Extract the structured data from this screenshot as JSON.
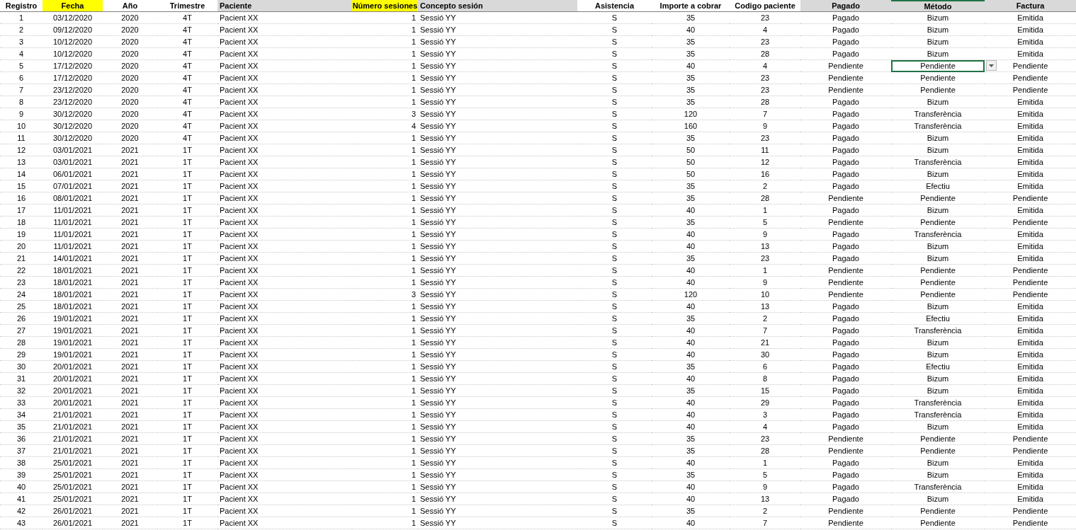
{
  "table": {
    "columns": [
      {
        "label": "Registro",
        "color": "#ffffff",
        "selected": false
      },
      {
        "label": "Fecha",
        "color": "#ffff00",
        "selected": false
      },
      {
        "label": "Año",
        "color": "#ffffff",
        "selected": false
      },
      {
        "label": "Trimestre",
        "color": "#ffffff",
        "selected": false
      },
      {
        "label": "Paciente",
        "color": "#d9d9d9",
        "selected": false
      },
      {
        "label": "Número sesiones",
        "color": "#ffff00",
        "selected": false
      },
      {
        "label": "Concepto sesión",
        "color": "#d9d9d9",
        "selected": false
      },
      {
        "label": "Asistencia",
        "color": "#ffffff",
        "selected": false
      },
      {
        "label": "Importe a cobrar",
        "color": "#ffffff",
        "selected": false
      },
      {
        "label": "Codigo paciente",
        "color": "#ffffff",
        "selected": false
      },
      {
        "label": "Pagado",
        "color": "#d9d9d9",
        "selected": false
      },
      {
        "label": "Método",
        "color": "#d9d9d9",
        "selected": true
      },
      {
        "label": "Factura",
        "color": "#d9d9d9",
        "selected": false
      }
    ],
    "rows": [
      {
        "selected": false,
        "cells": [
          "1",
          "03/12/2020",
          "2020",
          "4T",
          "Pacient XX",
          "1",
          "Sessió YY",
          "S",
          "35",
          "23",
          "Pagado",
          "Bizum",
          "Emitida"
        ]
      },
      {
        "selected": false,
        "cells": [
          "2",
          "09/12/2020",
          "2020",
          "4T",
          "Pacient XX",
          "1",
          "Sessió YY",
          "S",
          "40",
          "4",
          "Pagado",
          "Bizum",
          "Emitida"
        ]
      },
      {
        "selected": false,
        "cells": [
          "3",
          "10/12/2020",
          "2020",
          "4T",
          "Pacient XX",
          "1",
          "Sessió YY",
          "S",
          "35",
          "23",
          "Pagado",
          "Bizum",
          "Emitida"
        ]
      },
      {
        "selected": false,
        "cells": [
          "4",
          "10/12/2020",
          "2020",
          "4T",
          "Pacient XX",
          "1",
          "Sessió YY",
          "S",
          "35",
          "28",
          "Pagado",
          "Bizum",
          "Emitida"
        ]
      },
      {
        "selected": true,
        "cells": [
          "5",
          "17/12/2020",
          "2020",
          "4T",
          "Pacient XX",
          "1",
          "Sessió YY",
          "S",
          "40",
          "4",
          "Pendiente",
          "Pendiente",
          "Pendiente"
        ]
      },
      {
        "selected": false,
        "cells": [
          "6",
          "17/12/2020",
          "2020",
          "4T",
          "Pacient XX",
          "1",
          "Sessió YY",
          "S",
          "35",
          "23",
          "Pendiente",
          "Pendiente",
          "Pendiente"
        ]
      },
      {
        "selected": false,
        "cells": [
          "7",
          "23/12/2020",
          "2020",
          "4T",
          "Pacient XX",
          "1",
          "Sessió YY",
          "S",
          "35",
          "23",
          "Pendiente",
          "Pendiente",
          "Pendiente"
        ]
      },
      {
        "selected": false,
        "cells": [
          "8",
          "23/12/2020",
          "2020",
          "4T",
          "Pacient XX",
          "1",
          "Sessió YY",
          "S",
          "35",
          "28",
          "Pagado",
          "Bizum",
          "Emitida"
        ]
      },
      {
        "selected": false,
        "cells": [
          "9",
          "30/12/2020",
          "2020",
          "4T",
          "Pacient XX",
          "3",
          "Sessió YY",
          "S",
          "120",
          "7",
          "Pagado",
          "Transferència",
          "Emitida"
        ]
      },
      {
        "selected": false,
        "cells": [
          "10",
          "30/12/2020",
          "2020",
          "4T",
          "Pacient XX",
          "4",
          "Sessió YY",
          "S",
          "160",
          "9",
          "Pagado",
          "Transferència",
          "Emitida"
        ]
      },
      {
        "selected": false,
        "cells": [
          "11",
          "30/12/2020",
          "2020",
          "4T",
          "Pacient XX",
          "1",
          "Sessió YY",
          "S",
          "35",
          "23",
          "Pagado",
          "Bizum",
          "Emitida"
        ]
      },
      {
        "selected": false,
        "cells": [
          "12",
          "03/01/2021",
          "2021",
          "1T",
          "Pacient XX",
          "1",
          "Sessió YY",
          "S",
          "50",
          "11",
          "Pagado",
          "Bizum",
          "Emitida"
        ]
      },
      {
        "selected": false,
        "cells": [
          "13",
          "03/01/2021",
          "2021",
          "1T",
          "Pacient XX",
          "1",
          "Sessió YY",
          "S",
          "50",
          "12",
          "Pagado",
          "Transferència",
          "Emitida"
        ]
      },
      {
        "selected": false,
        "cells": [
          "14",
          "06/01/2021",
          "2021",
          "1T",
          "Pacient XX",
          "1",
          "Sessió YY",
          "S",
          "50",
          "16",
          "Pagado",
          "Bizum",
          "Emitida"
        ]
      },
      {
        "selected": false,
        "cells": [
          "15",
          "07/01/2021",
          "2021",
          "1T",
          "Pacient XX",
          "1",
          "Sessió YY",
          "S",
          "35",
          "2",
          "Pagado",
          "Efectiu",
          "Emitida"
        ]
      },
      {
        "selected": false,
        "cells": [
          "16",
          "08/01/2021",
          "2021",
          "1T",
          "Pacient XX",
          "1",
          "Sessió YY",
          "S",
          "35",
          "28",
          "Pendiente",
          "Pendiente",
          "Pendiente"
        ]
      },
      {
        "selected": false,
        "cells": [
          "17",
          "11/01/2021",
          "2021",
          "1T",
          "Pacient XX",
          "1",
          "Sessió YY",
          "S",
          "40",
          "1",
          "Pagado",
          "Bizum",
          "Emitida"
        ]
      },
      {
        "selected": false,
        "cells": [
          "18",
          "11/01/2021",
          "2021",
          "1T",
          "Pacient XX",
          "1",
          "Sessió YY",
          "S",
          "35",
          "5",
          "Pendiente",
          "Pendiente",
          "Pendiente"
        ]
      },
      {
        "selected": false,
        "cells": [
          "19",
          "11/01/2021",
          "2021",
          "1T",
          "Pacient XX",
          "1",
          "Sessió YY",
          "S",
          "40",
          "9",
          "Pagado",
          "Transferència",
          "Emitida"
        ]
      },
      {
        "selected": false,
        "cells": [
          "20",
          "11/01/2021",
          "2021",
          "1T",
          "Pacient XX",
          "1",
          "Sessió YY",
          "S",
          "40",
          "13",
          "Pagado",
          "Bizum",
          "Emitida"
        ]
      },
      {
        "selected": false,
        "cells": [
          "21",
          "14/01/2021",
          "2021",
          "1T",
          "Pacient XX",
          "1",
          "Sessió YY",
          "S",
          "35",
          "23",
          "Pagado",
          "Bizum",
          "Emitida"
        ]
      },
      {
        "selected": false,
        "cells": [
          "22",
          "18/01/2021",
          "2021",
          "1T",
          "Pacient XX",
          "1",
          "Sessió YY",
          "S",
          "40",
          "1",
          "Pendiente",
          "Pendiente",
          "Pendiente"
        ]
      },
      {
        "selected": false,
        "cells": [
          "23",
          "18/01/2021",
          "2021",
          "1T",
          "Pacient XX",
          "1",
          "Sessió YY",
          "S",
          "40",
          "9",
          "Pendiente",
          "Pendiente",
          "Pendiente"
        ]
      },
      {
        "selected": false,
        "cells": [
          "24",
          "18/01/2021",
          "2021",
          "1T",
          "Pacient XX",
          "3",
          "Sessió YY",
          "S",
          "120",
          "10",
          "Pendiente",
          "Pendiente",
          "Pendiente"
        ]
      },
      {
        "selected": false,
        "cells": [
          "25",
          "18/01/2021",
          "2021",
          "1T",
          "Pacient XX",
          "1",
          "Sessió YY",
          "S",
          "40",
          "13",
          "Pagado",
          "Bizum",
          "Emitida"
        ]
      },
      {
        "selected": false,
        "cells": [
          "26",
          "19/01/2021",
          "2021",
          "1T",
          "Pacient XX",
          "1",
          "Sessió YY",
          "S",
          "35",
          "2",
          "Pagado",
          "Efectiu",
          "Emitida"
        ]
      },
      {
        "selected": false,
        "cells": [
          "27",
          "19/01/2021",
          "2021",
          "1T",
          "Pacient XX",
          "1",
          "Sessió YY",
          "S",
          "40",
          "7",
          "Pagado",
          "Transferència",
          "Emitida"
        ]
      },
      {
        "selected": false,
        "cells": [
          "28",
          "19/01/2021",
          "2021",
          "1T",
          "Pacient XX",
          "1",
          "Sessió YY",
          "S",
          "40",
          "21",
          "Pagado",
          "Bizum",
          "Emitida"
        ]
      },
      {
        "selected": false,
        "cells": [
          "29",
          "19/01/2021",
          "2021",
          "1T",
          "Pacient XX",
          "1",
          "Sessió YY",
          "S",
          "40",
          "30",
          "Pagado",
          "Bizum",
          "Emitida"
        ]
      },
      {
        "selected": false,
        "cells": [
          "30",
          "20/01/2021",
          "2021",
          "1T",
          "Pacient XX",
          "1",
          "Sessió YY",
          "S",
          "35",
          "6",
          "Pagado",
          "Efectiu",
          "Emitida"
        ]
      },
      {
        "selected": false,
        "cells": [
          "31",
          "20/01/2021",
          "2021",
          "1T",
          "Pacient XX",
          "1",
          "Sessió YY",
          "S",
          "40",
          "8",
          "Pagado",
          "Bizum",
          "Emitida"
        ]
      },
      {
        "selected": false,
        "cells": [
          "32",
          "20/01/2021",
          "2021",
          "1T",
          "Pacient XX",
          "1",
          "Sessió YY",
          "S",
          "35",
          "15",
          "Pagado",
          "Bizum",
          "Emitida"
        ]
      },
      {
        "selected": false,
        "cells": [
          "33",
          "20/01/2021",
          "2021",
          "1T",
          "Pacient XX",
          "1",
          "Sessió YY",
          "S",
          "40",
          "29",
          "Pagado",
          "Transferència",
          "Emitida"
        ]
      },
      {
        "selected": false,
        "cells": [
          "34",
          "21/01/2021",
          "2021",
          "1T",
          "Pacient XX",
          "1",
          "Sessió YY",
          "S",
          "40",
          "3",
          "Pagado",
          "Transferència",
          "Emitida"
        ]
      },
      {
        "selected": false,
        "cells": [
          "35",
          "21/01/2021",
          "2021",
          "1T",
          "Pacient XX",
          "1",
          "Sessió YY",
          "S",
          "40",
          "4",
          "Pagado",
          "Bizum",
          "Emitida"
        ]
      },
      {
        "selected": false,
        "cells": [
          "36",
          "21/01/2021",
          "2021",
          "1T",
          "Pacient XX",
          "1",
          "Sessió YY",
          "S",
          "35",
          "23",
          "Pendiente",
          "Pendiente",
          "Pendiente"
        ]
      },
      {
        "selected": false,
        "cells": [
          "37",
          "21/01/2021",
          "2021",
          "1T",
          "Pacient XX",
          "1",
          "Sessió YY",
          "S",
          "35",
          "28",
          "Pendiente",
          "Pendiente",
          "Pendiente"
        ]
      },
      {
        "selected": false,
        "cells": [
          "38",
          "25/01/2021",
          "2021",
          "1T",
          "Pacient XX",
          "1",
          "Sessió YY",
          "S",
          "40",
          "1",
          "Pagado",
          "Bizum",
          "Emitida"
        ]
      },
      {
        "selected": false,
        "cells": [
          "39",
          "25/01/2021",
          "2021",
          "1T",
          "Pacient XX",
          "1",
          "Sessió YY",
          "S",
          "35",
          "5",
          "Pagado",
          "Bizum",
          "Emitida"
        ]
      },
      {
        "selected": false,
        "cells": [
          "40",
          "25/01/2021",
          "2021",
          "1T",
          "Pacient XX",
          "1",
          "Sessió YY",
          "S",
          "40",
          "9",
          "Pagado",
          "Transferència",
          "Emitida"
        ]
      },
      {
        "selected": false,
        "cells": [
          "41",
          "25/01/2021",
          "2021",
          "1T",
          "Pacient XX",
          "1",
          "Sessió YY",
          "S",
          "40",
          "13",
          "Pagado",
          "Bizum",
          "Emitida"
        ]
      },
      {
        "selected": false,
        "cells": [
          "42",
          "26/01/2021",
          "2021",
          "1T",
          "Pacient XX",
          "1",
          "Sessió YY",
          "S",
          "35",
          "2",
          "Pendiente",
          "Pendiente",
          "Pendiente"
        ]
      },
      {
        "selected": false,
        "cells": [
          "43",
          "26/01/2021",
          "2021",
          "1T",
          "Pacient XX",
          "1",
          "Sessió YY",
          "S",
          "40",
          "7",
          "Pendiente",
          "Pendiente",
          "Pendiente"
        ]
      }
    ]
  }
}
